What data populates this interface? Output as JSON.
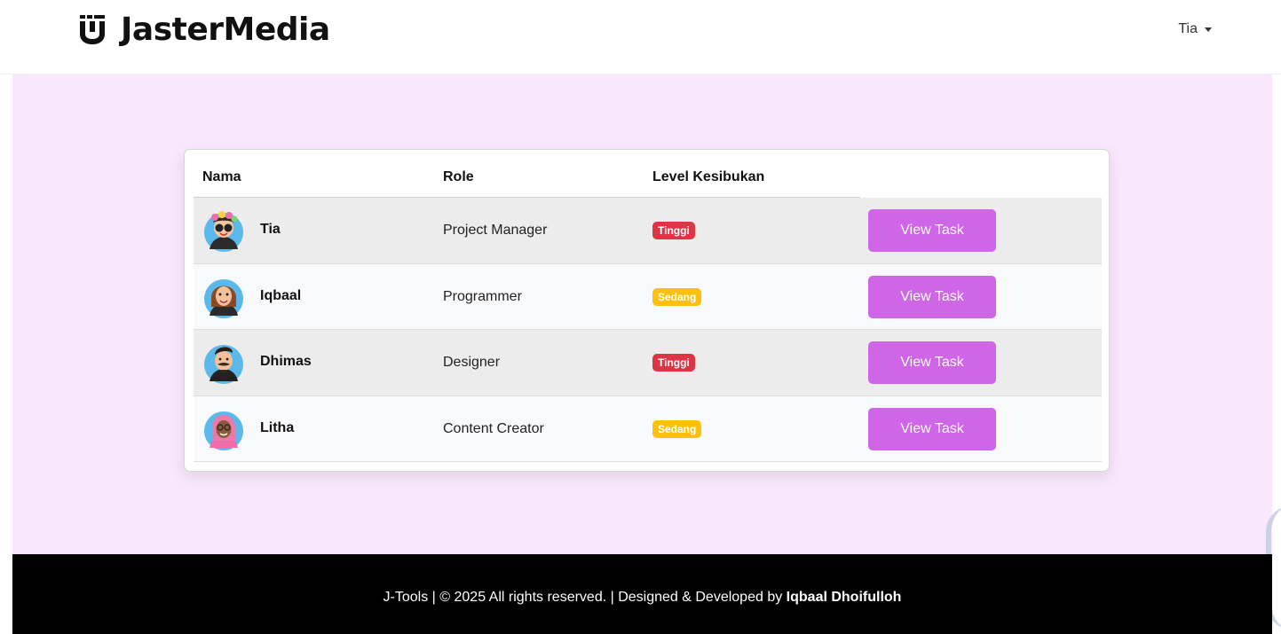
{
  "navbar": {
    "brand": "JasterMedia",
    "user": "Tia"
  },
  "table": {
    "headers": {
      "name": "Nama",
      "role": "Role",
      "level": "Level Kesibukan"
    },
    "rows": [
      {
        "name": "Tia",
        "role": "Project Manager",
        "level": "Tinggi",
        "level_color": "#dc3545",
        "button": "View Task"
      },
      {
        "name": "Iqbaal",
        "role": "Programmer",
        "level": "Sedang",
        "level_color": "#ffc107",
        "button": "View Task"
      },
      {
        "name": "Dhimas",
        "role": "Designer",
        "level": "Tinggi",
        "level_color": "#dc3545",
        "button": "View Task"
      },
      {
        "name": "Litha",
        "role": "Content Creator",
        "level": "Sedang",
        "level_color": "#ffc107",
        "button": "View Task"
      }
    ]
  },
  "footer": {
    "text": "J-Tools | © 2025 All rights reserved. | Designed & Developed by",
    "author": "Iqbaal Dhoifulloh"
  },
  "colors": {
    "accent": "#cf66e8",
    "page_bg": "#f9e8fd",
    "footer_bg": "#000000"
  }
}
